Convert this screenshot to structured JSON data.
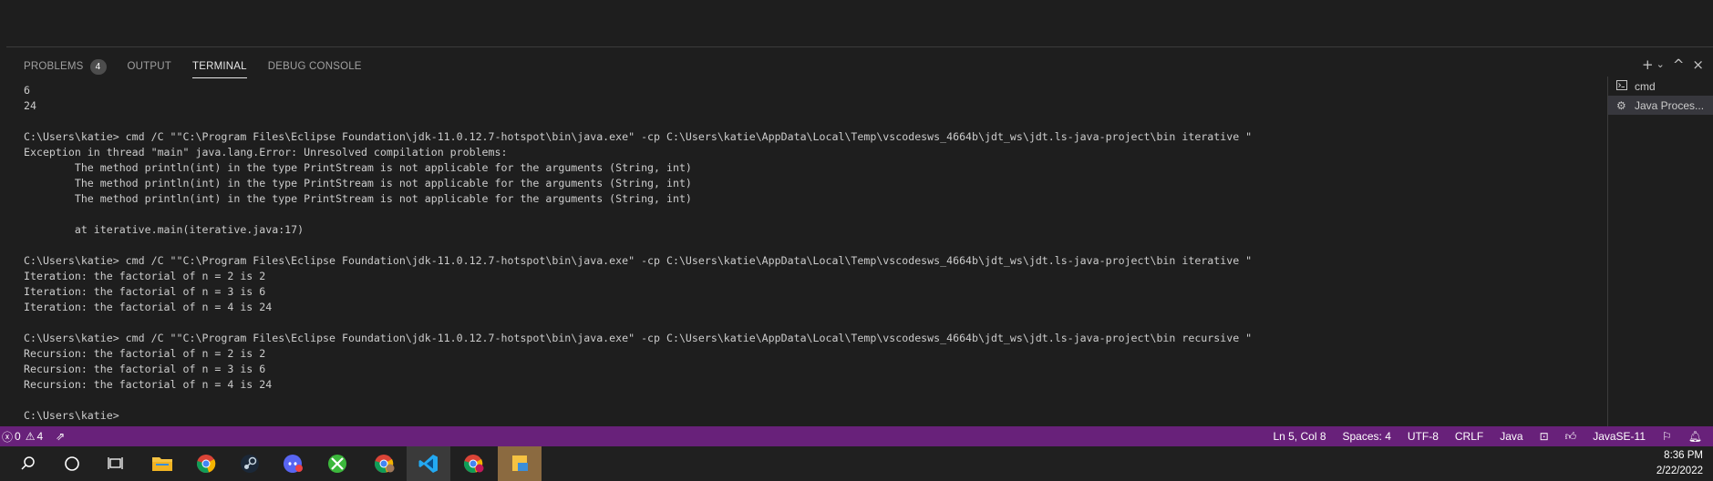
{
  "panel": {
    "tabs": [
      {
        "label": "PROBLEMS",
        "badge": "4"
      },
      {
        "label": "OUTPUT"
      },
      {
        "label": "TERMINAL"
      },
      {
        "label": "DEBUG CONSOLE"
      }
    ],
    "actions": {
      "add": "+",
      "split": "⌄",
      "maximize": "^",
      "close": "×"
    }
  },
  "terminal": {
    "lines": [
      "6",
      "24",
      "",
      "C:\\Users\\katie> cmd /C \"\"C:\\Program Files\\Eclipse Foundation\\jdk-11.0.12.7-hotspot\\bin\\java.exe\" -cp C:\\Users\\katie\\AppData\\Local\\Temp\\vscodesws_4664b\\jdt_ws\\jdt.ls-java-project\\bin iterative \"",
      "Exception in thread \"main\" java.lang.Error: Unresolved compilation problems:",
      "        The method println(int) in the type PrintStream is not applicable for the arguments (String, int)",
      "        The method println(int) in the type PrintStream is not applicable for the arguments (String, int)",
      "        The method println(int) in the type PrintStream is not applicable for the arguments (String, int)",
      "",
      "        at iterative.main(iterative.java:17)",
      "",
      "C:\\Users\\katie> cmd /C \"\"C:\\Program Files\\Eclipse Foundation\\jdk-11.0.12.7-hotspot\\bin\\java.exe\" -cp C:\\Users\\katie\\AppData\\Local\\Temp\\vscodesws_4664b\\jdt_ws\\jdt.ls-java-project\\bin iterative \"",
      "Iteration: the factorial of n = 2 is 2",
      "Iteration: the factorial of n = 3 is 6",
      "Iteration: the factorial of n = 4 is 24",
      "",
      "C:\\Users\\katie> cmd /C \"\"C:\\Program Files\\Eclipse Foundation\\jdk-11.0.12.7-hotspot\\bin\\java.exe\" -cp C:\\Users\\katie\\AppData\\Local\\Temp\\vscodesws_4664b\\jdt_ws\\jdt.ls-java-project\\bin recursive \"",
      "Recursion: the factorial of n = 2 is 2",
      "Recursion: the factorial of n = 3 is 6",
      "Recursion: the factorial of n = 4 is 24",
      "",
      "C:\\Users\\katie>"
    ],
    "instances": [
      {
        "label": "cmd",
        "icon": "terminal-icon"
      },
      {
        "label": "Java Proces...",
        "icon": "debug-gear-icon"
      }
    ]
  },
  "statusbar": {
    "errors": "0",
    "warnings": "4",
    "position": "Ln 5, Col 8",
    "spaces": "Spaces: 4",
    "encoding": "UTF-8",
    "eol": "CRLF",
    "language": "Java",
    "java_version": "JavaSE-11",
    "colors": {
      "background": "#68217a"
    }
  },
  "taskbar": {
    "icons": [
      "search-icon",
      "cortana-icon",
      "task-view-icon",
      "file-explorer-icon",
      "chrome-icon",
      "steam-icon",
      "discord-icon",
      "xbox-icon",
      "chrome-profile-icon",
      "vscode-icon",
      "chrome-profile-k-icon",
      "sticky-app-icon"
    ],
    "time": "8:36 PM",
    "date": "2/22/2022"
  }
}
